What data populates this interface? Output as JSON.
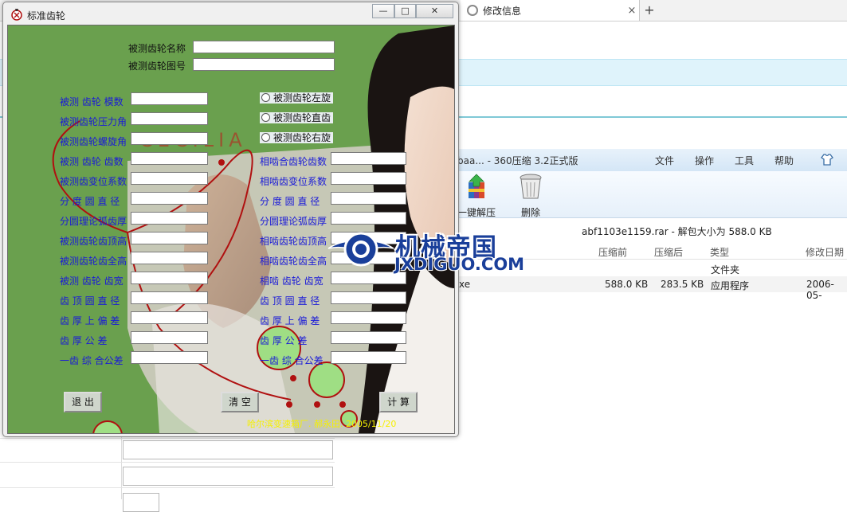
{
  "browser": {
    "tab_title": "修改信息",
    "tab_close": "×",
    "new_tab": "+"
  },
  "zip": {
    "title": "baa... - 360压缩 3.2正式版",
    "menu": [
      "文件",
      "操作",
      "工具",
      "帮助"
    ],
    "toolbar": {
      "extract_label": "一键解压",
      "delete_label": "删除"
    },
    "path_text": "abf1103e1159.rar - 解包大小为 588.0 KB",
    "columns": [
      "压缩前",
      "压缩后",
      "类型",
      "修改日期"
    ],
    "rows": [
      {
        "name": "",
        "before": "",
        "after": "",
        "type": "文件夹",
        "date": ""
      },
      {
        "name": "xe",
        "before": "588.0 KB",
        "after": "283.5 KB",
        "type": "应用程序",
        "date": "2006-05-"
      }
    ]
  },
  "dialog": {
    "title": "标准齿轮",
    "minimize": "—",
    "maximize": "□",
    "close": "✕",
    "name_label": "被测齿轮名称",
    "drawing_label": "被测齿轮图号",
    "left_labels": [
      "被测 齿轮 模数",
      "被测齿轮压力角",
      "被测齿轮螺旋角",
      "被测 齿轮 齿数",
      "被测齿变位系数",
      "分 度 圆 直 径",
      "分圆理论弧齿厚",
      "被测齿轮齿顶高",
      "被测齿轮齿全高",
      "被测 齿轮 齿宽",
      "齿 顶 圆 直 径",
      "齿 厚 上 偏 差",
      "齿 厚 公 差",
      "一齿 综 合公差"
    ],
    "right_labels": [
      "相啮合齿轮齿数",
      "相啮齿变位系数",
      "分 度 圆 直 径",
      "分圆理论弧齿厚",
      "相啮齿轮齿顶高",
      "相啮齿轮齿全高",
      "相啮 齿轮 齿宽",
      "齿 顶 圆 直 径",
      "齿 厚 上 偏 差",
      "齿 厚 公 差",
      "一齿 综 合公差"
    ],
    "radios": [
      "被测齿轮左旋",
      "被测齿轮直齿",
      "被测齿轮右旋"
    ],
    "buttons": {
      "exit": "退 出",
      "clear": "清 空",
      "calc": "计 算"
    },
    "credit": "哈尔滨变速箱厂. 郝永田. 2005/11/20",
    "bg_text": "CECILIA"
  },
  "watermark": {
    "cn": "机械帝国",
    "en": "JXDIGUO.COM"
  },
  "colors": {
    "client_green": "#6aa04e",
    "label_blue": "#1a1ad8",
    "credit_yellow": "#f5f000",
    "heart_red": "#b01010"
  }
}
